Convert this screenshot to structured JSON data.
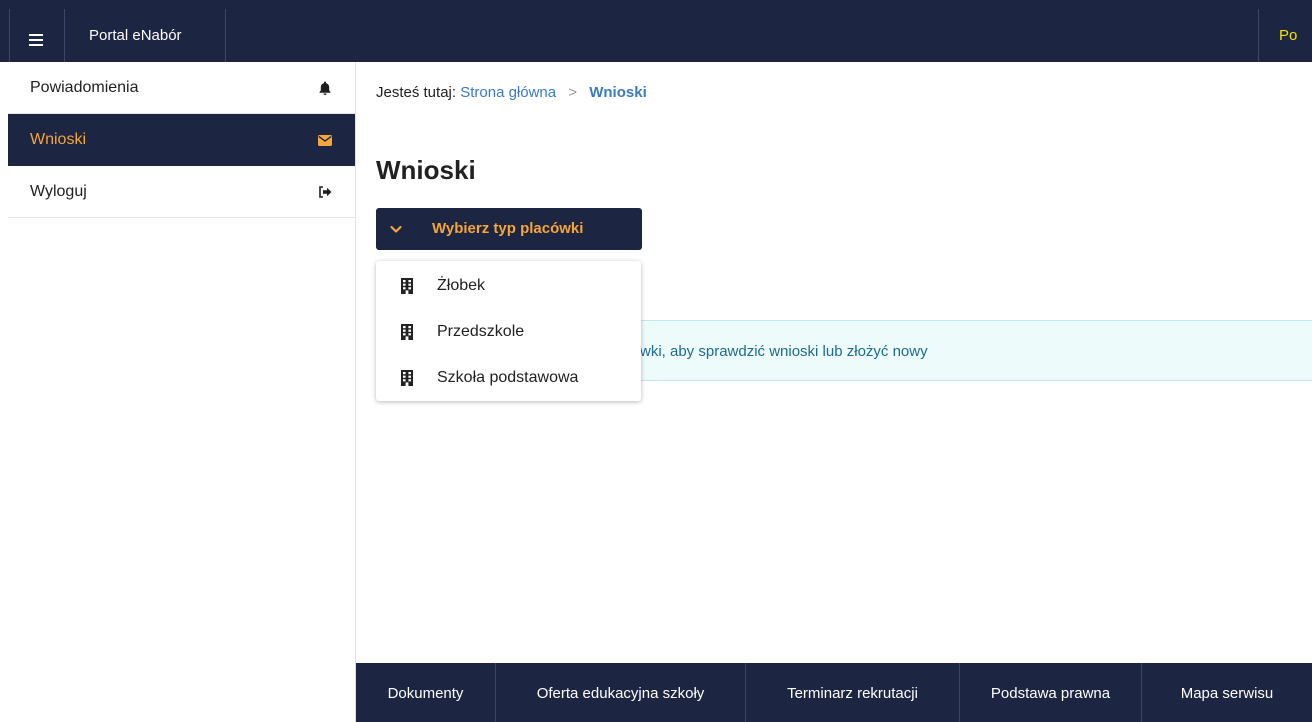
{
  "header": {
    "brand": "Portal eNabór",
    "right_link": "Po"
  },
  "sidebar": {
    "items": [
      {
        "label": "Powiadomienia",
        "icon": "bell-icon"
      },
      {
        "label": "Wnioski",
        "icon": "envelope-icon",
        "active": true
      },
      {
        "label": "Wyloguj",
        "icon": "sign-out-icon"
      }
    ]
  },
  "breadcrumb": {
    "prefix": "Jesteś tutaj:",
    "home": "Strona główna",
    "separator": ">",
    "current": "Wnioski"
  },
  "main": {
    "title": "Wnioski",
    "dropdown": {
      "label": "Wybierz typ placówki",
      "options": [
        "Żłobek",
        "Przedszkole",
        "Szkoła podstawowa"
      ],
      "option_icon": "building-icon"
    },
    "info": "wki, aby sprawdzić wnioski lub złożyć nowy"
  },
  "footer": {
    "links": [
      "Dokumenty",
      "Oferta edukacyjna szkoły",
      "Terminarz rekrutacji",
      "Podstawa prawna",
      "Mapa serwisu"
    ]
  },
  "colors": {
    "navy": "#1c2541",
    "accent_orange": "#f6a53a",
    "link_blue": "#3c7bbf",
    "info_bg": "#edfbfb",
    "top_right_yellow": "#f5e200"
  }
}
